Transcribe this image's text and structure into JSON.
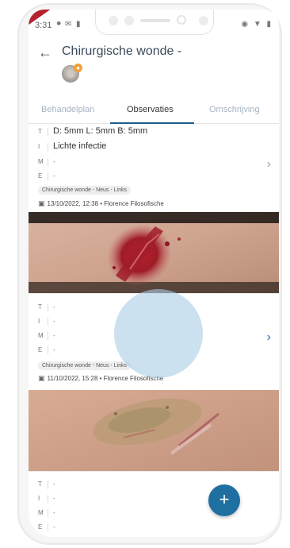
{
  "status": {
    "time": "3:31"
  },
  "header": {
    "title": "Chirurgische wonde -"
  },
  "tabs": [
    {
      "label": "Behandelplan"
    },
    {
      "label": "Observaties"
    },
    {
      "label": "Omschrijving"
    }
  ],
  "active_tab": "Observaties",
  "observations": [
    {
      "rows": [
        {
          "letter": "T",
          "value": "D: 5mm L: 5mm B: 5mm"
        },
        {
          "letter": "I",
          "value": "Lichte infectie"
        },
        {
          "letter": "M",
          "value": "-"
        },
        {
          "letter": "E",
          "value": "-"
        }
      ],
      "tag": "Chirurgische wonde - Neus - Links",
      "meta": "13/10/2022, 12:38 • Florence Filosofische"
    },
    {
      "rows": [
        {
          "letter": "T",
          "value": "-"
        },
        {
          "letter": "I",
          "value": "-"
        },
        {
          "letter": "M",
          "value": "-"
        },
        {
          "letter": "E",
          "value": "-"
        }
      ],
      "tag": "Chirurgische wonde - Neus - Links",
      "meta": "11/10/2022, 15:28 • Florence Filosofische"
    },
    {
      "rows": [
        {
          "letter": "T",
          "value": "-"
        },
        {
          "letter": "I",
          "value": "-"
        },
        {
          "letter": "M",
          "value": "-"
        },
        {
          "letter": "E",
          "value": "-"
        }
      ]
    }
  ],
  "icons": {
    "back": "arrow-left-icon",
    "chevron": "chevron-right-icon",
    "camera": "camera-icon",
    "fab": "plus-icon"
  },
  "colors": {
    "accent": "#1f5d8a",
    "fab": "#1f6fa1",
    "tab_inactive": "#a8b4c2"
  }
}
